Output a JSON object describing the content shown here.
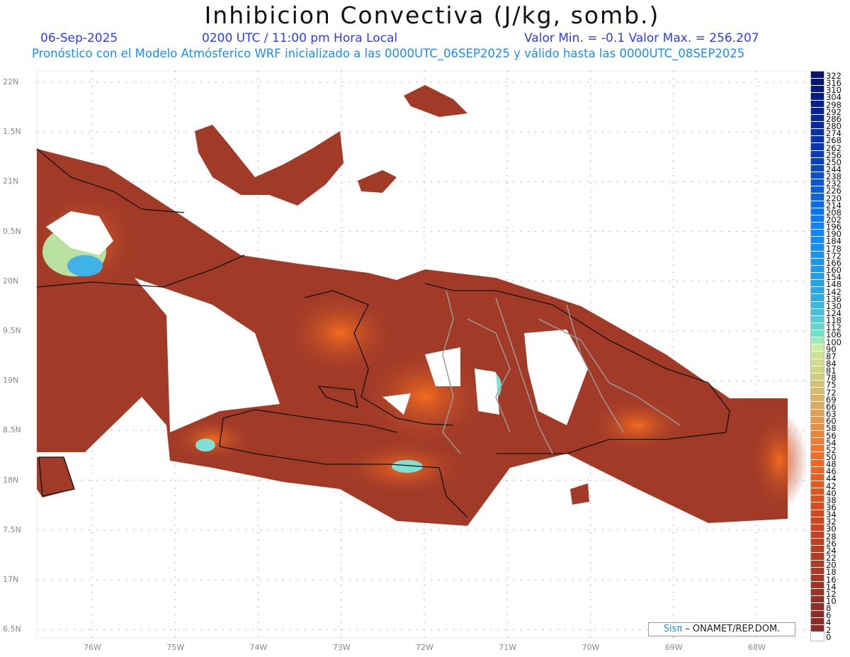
{
  "header": {
    "title": "Inhibicion Convectiva (J/kg, somb.)",
    "date": "06-Sep-2025",
    "time": "0200 UTC / 11:00 pm Hora Local",
    "min_max": "Valor Min. = -0.1  Valor Max. = 256.207",
    "subtitle": "Pronóstico con el Modelo Atmósferico WRF inicializado a las 0000UTC_06SEP2025 y válido hasta las  0000UTC_08SEP2025"
  },
  "map": {
    "lat_labels": [
      "22N",
      "1.5N",
      "21N",
      "0.5N",
      "20N",
      "9.5N",
      "19N",
      "8.5N",
      "18N",
      "7.5N",
      "17N",
      "6.5N"
    ],
    "lon_labels": [
      "76W",
      "75W",
      "74W",
      "73W",
      "72W",
      "71W",
      "70W",
      "69W",
      "68W"
    ],
    "lat_range": [
      6.5,
      22
    ],
    "lon_range": [
      -76.67,
      -67.55
    ]
  },
  "colorbar": {
    "labels": [
      "322",
      "316",
      "310",
      "304",
      "298",
      "292",
      "286",
      "280",
      "274",
      "268",
      "262",
      "256",
      "250",
      "244",
      "238",
      "232",
      "226",
      "220",
      "214",
      "208",
      "202",
      "196",
      "190",
      "184",
      "178",
      "172",
      "166",
      "160",
      "154",
      "148",
      "142",
      "136",
      "130",
      "124",
      "118",
      "112",
      "106",
      "100",
      "90",
      "87",
      "84",
      "81",
      "78",
      "75",
      "72",
      "69",
      "66",
      "63",
      "60",
      "58",
      "56",
      "54",
      "52",
      "50",
      "48",
      "46",
      "44",
      "42",
      "40",
      "38",
      "36",
      "34",
      "32",
      "30",
      "28",
      "26",
      "24",
      "22",
      "20",
      "18",
      "16",
      "14",
      "12",
      "10",
      "8",
      "6",
      "4",
      "2",
      "0"
    ]
  },
  "credit": {
    "sis": "Sis",
    "pi": "π",
    "org": " – ONAMET/REP.DOM."
  }
}
